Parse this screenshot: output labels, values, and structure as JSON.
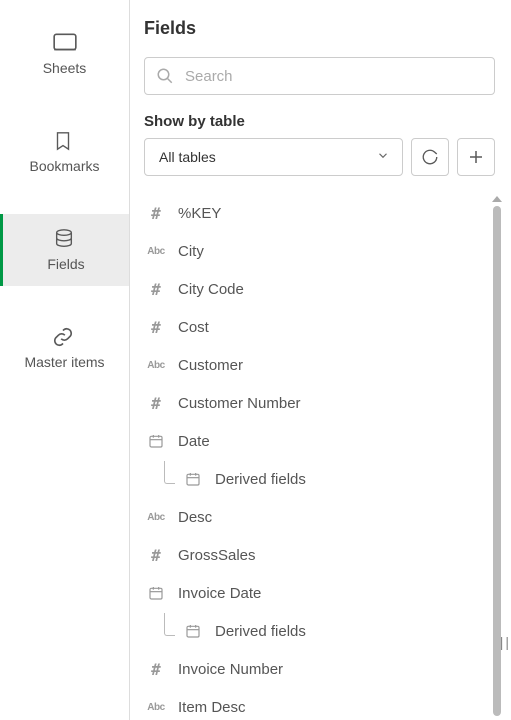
{
  "sidebar": {
    "sheets": "Sheets",
    "bookmarks": "Bookmarks",
    "fields": "Fields",
    "master_items": "Master items"
  },
  "panel": {
    "title": "Fields",
    "search_placeholder": "Search",
    "show_by_label": "Show by table",
    "table_select": "All tables"
  },
  "fields": [
    {
      "type": "num",
      "label": "%KEY"
    },
    {
      "type": "abc",
      "label": "City"
    },
    {
      "type": "num",
      "label": "City Code"
    },
    {
      "type": "num",
      "label": "Cost"
    },
    {
      "type": "abc",
      "label": "Customer"
    },
    {
      "type": "num",
      "label": "Customer Number"
    },
    {
      "type": "date",
      "label": "Date",
      "has_child": true
    },
    {
      "type": "date",
      "label": "Derived fields",
      "child": true
    },
    {
      "type": "abc",
      "label": "Desc"
    },
    {
      "type": "num",
      "label": "GrossSales"
    },
    {
      "type": "date",
      "label": "Invoice Date",
      "has_child": true
    },
    {
      "type": "date",
      "label": "Derived fields",
      "child": true
    },
    {
      "type": "num",
      "label": "Invoice Number"
    },
    {
      "type": "abc",
      "label": "Item Desc"
    }
  ]
}
